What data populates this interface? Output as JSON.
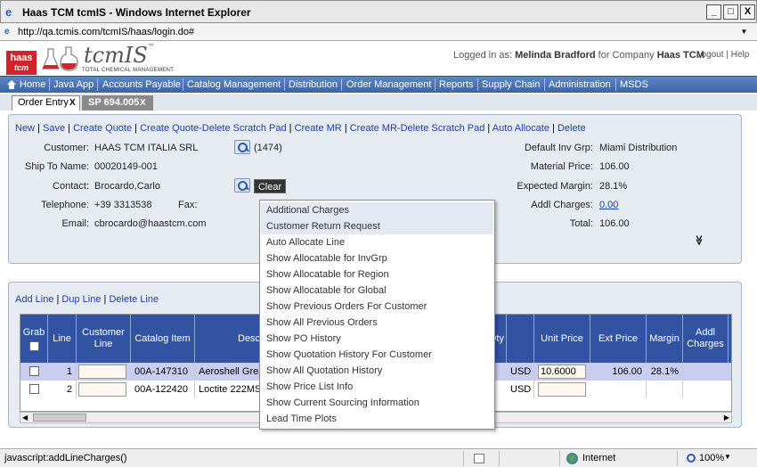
{
  "window": {
    "title": "Haas TCM tcmIS - Windows Internet Explorer",
    "min": "_",
    "max": "□",
    "close": "X"
  },
  "address": {
    "url": "http://qa.tcmis.com/tcmIS/haas/login.do#"
  },
  "header": {
    "logo_top": "haas",
    "logo_bottom": "tcm",
    "brand": "tcmIS",
    "brand_tm": "™",
    "tagline": "TOTAL CHEMICAL MANAGEMENT",
    "logged_in_prefix": "Logged in as:",
    "user": "Melinda Bradford",
    "company_prefix": "for Company",
    "company": "Haas TCM",
    "logout": "Logout",
    "help": "Help",
    "links_sep": "|"
  },
  "menu": [
    "Home",
    "Java App",
    "Accounts Payable",
    "Catalog Management",
    "Distribution",
    "Order Management",
    "Reports",
    "Supply Chain",
    "Administration",
    "MSDS"
  ],
  "tabs": [
    {
      "label": "Order Entry",
      "close": "X"
    },
    {
      "label": "SP 694.005",
      "close": "X"
    }
  ],
  "actions": [
    "New",
    "Save",
    "Create Quote",
    "Create Quote-Delete Scratch Pad",
    "Create MR",
    "Create MR-Delete Scratch Pad",
    "Auto Allocate",
    "Delete"
  ],
  "action_sep": "|",
  "form": {
    "customer_label": "Customer:",
    "customer": "HAAS TCM ITALIA SRL",
    "customer_count": "(1474)",
    "shipto_label": "Ship To Name:",
    "shipto": "00020149-001",
    "contact_label": "Contact:",
    "contact": "Brocardo,Carlo",
    "clear": "Clear",
    "telephone_label": "Telephone:",
    "telephone": "+39 3313538",
    "fax_label": "Fax:",
    "email_label": "Email:",
    "email": "cbrocardo@haastcm.com",
    "default_inv_label": "Default Inv Grp:",
    "default_inv": "Miami Distribution",
    "material_price_label": "Material Price:",
    "material_price": "106.00",
    "expected_margin_label": "Expected Margin:",
    "expected_margin": "28.1%",
    "addl_charges_label": "Addl Charges:",
    "addl_charges": "0.00",
    "total_label": "Total:",
    "total": "106.00",
    "expand": "≫"
  },
  "line_actions": [
    "Add Line",
    "Dup Line",
    "Delete Line"
  ],
  "grid": {
    "headers": [
      "Grab",
      "Line",
      "Customer Line",
      "Catalog Item",
      "Desc",
      "Qty",
      "",
      "Unit Price",
      "Ext Price",
      "Margin",
      "Addl Charges"
    ],
    "rows": [
      {
        "line": "1",
        "catalog": "00A-147310",
        "desc": "Aeroshell Grea",
        "currency": "USD",
        "unit_price": "10.6000",
        "ext_price": "106.00",
        "margin": "28.1%"
      },
      {
        "line": "2",
        "catalog": "00A-122420",
        "desc": "Loctite 222MS",
        "currency": "USD",
        "unit_price": "",
        "ext_price": "",
        "margin": ""
      }
    ]
  },
  "context_menu": [
    "Additional Charges",
    "Customer Return Request",
    "Auto Allocate Line",
    "Show Allocatable for InvGrp",
    "Show Allocatable for Region",
    "Show Allocatable for Global",
    "Show Previous Orders For Customer",
    "Show All Previous Orders",
    "Show PO History",
    "Show Quotation History For Customer",
    "Show All Quotation History",
    "Show Price List Info",
    "Show Current Sourcing Information",
    "Lead Time Plots"
  ],
  "status": {
    "text": "javascript:addLineCharges()",
    "zone": "Internet",
    "zoom": "100%"
  },
  "colors": {
    "menubar": "#3b64a8",
    "grid_header": "#3253a2",
    "link": "#1a3fa8",
    "panel": "#e7ebf2",
    "selected_row": "#c9cdf0"
  }
}
